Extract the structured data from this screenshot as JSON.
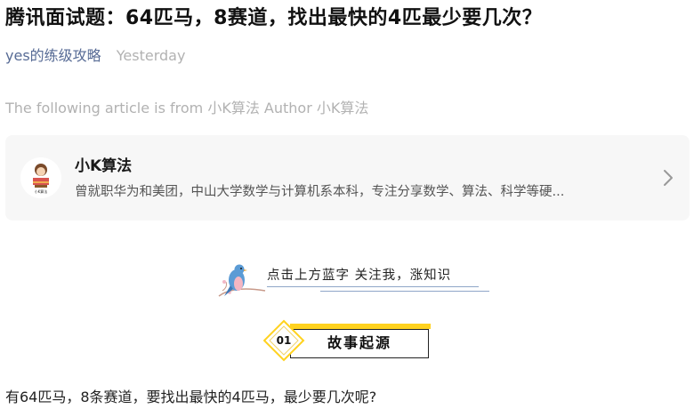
{
  "article": {
    "title": "腾讯面试题：64匹马，8赛道，找出最快的4匹最少要几次？",
    "account_name": "yes的练级攻略",
    "publish_time": "Yesterday",
    "source_line": "The following article is from 小K算法 Author 小K算法"
  },
  "source_card": {
    "name": "小K算法",
    "description": "曾就职华为和美团，中山大学数学与计算机系本科，专注分享数学、算法、科学等硬...",
    "avatar_text": "小K算法",
    "chevron_icon": "chevron-right-icon"
  },
  "banner": {
    "follow_text": "点击上方蓝字 关注我，涨知识",
    "bird_icon": "bluebird-icon"
  },
  "section": {
    "number": "01",
    "heading": "故事起源",
    "accent_color": "#ffd21f"
  },
  "content": {
    "first_paragraph": "有64匹马，8条赛道，要找出最快的4匹马，最少要几次呢?"
  },
  "colors": {
    "link": "#576b95",
    "muted": "#b2b2b2",
    "card_bg": "#f7f7f7"
  }
}
